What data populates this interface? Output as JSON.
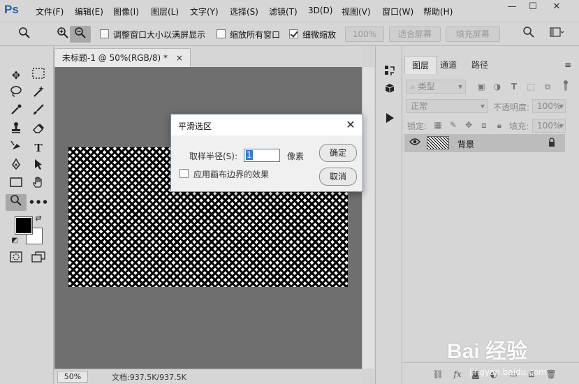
{
  "app": {
    "logo": "Ps"
  },
  "menu": [
    "文件(F)",
    "编辑(E)",
    "图像(I)",
    "图层(L)",
    "文字(Y)",
    "选择(S)",
    "滤镜(T)",
    "3D(D)",
    "视图(V)",
    "窗口(W)",
    "帮助(H)"
  ],
  "window_buttons": {
    "minimize": "—",
    "maximize": "☐",
    "close": "✕"
  },
  "options_bar": {
    "resize_window_label": "调整窗口大小以满屏显示",
    "zoom_all_windows_label": "缩放所有窗口",
    "scrubby_zoom_label": "细微缩放",
    "scrubby_zoom_checked": true,
    "zoom_100_button": "100%",
    "fit_screen_button": "适合屏幕",
    "fill_screen_button": "填充屏幕"
  },
  "document": {
    "tab_title": "未标题-1 @ 50%(RGB/8) *",
    "close_glyph": "×",
    "zoom": "50%",
    "info": "文档:937.5K/937.5K"
  },
  "layers_panel": {
    "tabs": [
      "图层",
      "通道",
      "路径"
    ],
    "filter_kind": "类型",
    "blend_mode": "正常",
    "opacity_label": "不透明度:",
    "opacity_value": "100%",
    "lock_label": "锁定:",
    "fill_label": "填充:",
    "fill_value": "100%",
    "layer_name": "背景"
  },
  "dialog": {
    "title": "平滑选区",
    "sample_radius_label": "取样半径(S):",
    "sample_radius_value": "1",
    "unit": "像素",
    "apply_edge_label": "应用画布边界的效果",
    "ok_button": "确定",
    "cancel_button": "取消",
    "close_glyph": "✕"
  },
  "watermark": {
    "main": "Bai 经验",
    "sub": "jingyan.baidu.com"
  },
  "colors": {
    "foreground": "#000000",
    "background": "#ffffff",
    "canvas_bg": "#6f6f6f",
    "accent": "#3478d6"
  }
}
